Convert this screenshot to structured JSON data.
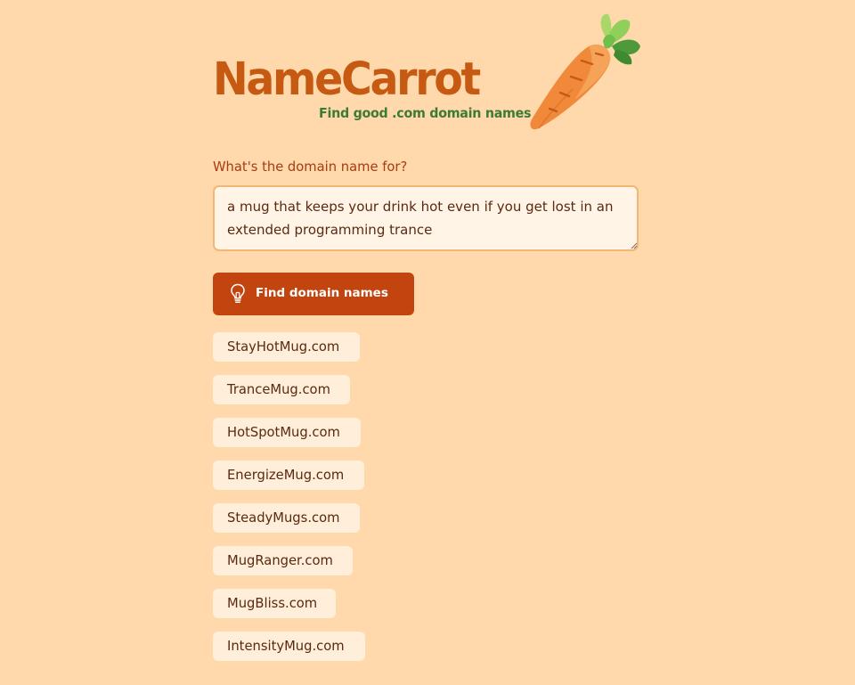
{
  "logo": {
    "wordmark": "NameCarrot",
    "tagline": "Find good .com domain names",
    "icon": "carrot-icon",
    "colors": {
      "wordmark": "#c75a12",
      "tagline": "#3f7a34"
    }
  },
  "form": {
    "prompt_label": "What's the domain name for?",
    "description_value": "a mug that keeps your drink hot even if you get lost in an extended programming trance",
    "submit_label": "Find domain names",
    "submit_icon": "lightbulb-icon"
  },
  "results": [
    "StayHotMug.com",
    "TranceMug.com",
    "HotSpotMug.com",
    "EnergizeMug.com",
    "SteadyMugs.com",
    "MugRanger.com",
    "MugBliss.com",
    "IntensityMug.com"
  ],
  "colors": {
    "background": "#ffd9ab",
    "accent": "#c24510",
    "chip": "#ffeed9",
    "input_bg": "#fff4e6",
    "input_border": "#f3b675"
  }
}
